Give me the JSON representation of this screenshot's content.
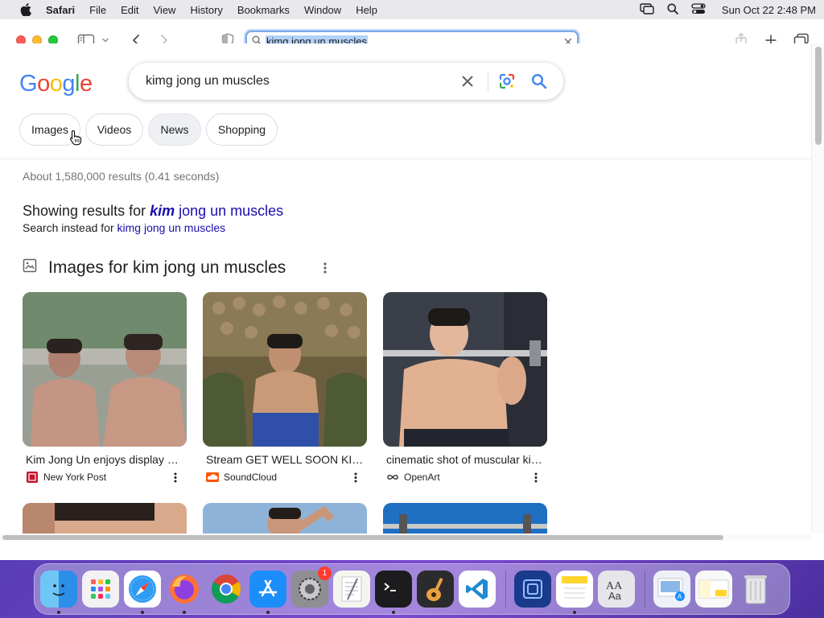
{
  "menubar": {
    "app_name": "Safari",
    "items": [
      "File",
      "Edit",
      "View",
      "History",
      "Bookmarks",
      "Window",
      "Help"
    ],
    "clock": "Sun Oct 22  2:48 PM"
  },
  "browser": {
    "address_text": "kimg jong un muscles"
  },
  "google": {
    "logo": [
      "G",
      "o",
      "o",
      "g",
      "l",
      "e"
    ],
    "logo_colors": [
      "#4285f4",
      "#ea4335",
      "#fbbc05",
      "#4285f4",
      "#34a853",
      "#ea4335"
    ],
    "query": "kimg jong un muscles",
    "chips": [
      "Images",
      "Videos",
      "News",
      "Shopping"
    ],
    "result_stats": "About 1,580,000 results (0.41 seconds)",
    "showing_prefix": "Showing results for ",
    "showing_corrected_bold": "kim",
    "showing_corrected_rest": " jong un muscles",
    "instead_prefix": "Search instead for ",
    "instead_link": "kimg jong un muscles",
    "images_section_title": "Images for kim jong un muscles",
    "image_results": [
      {
        "title": "Kim Jong Un enjoys display of ...",
        "source": "New York Post",
        "favicon": "nypost-icon"
      },
      {
        "title": "Stream GET WELL SOON KIM JONG UN",
        "source": "SoundCloud",
        "favicon": "soundcloud-icon"
      },
      {
        "title": "cinematic shot of muscular kim jong un",
        "source": "OpenArt",
        "favicon": "openart-icon"
      }
    ]
  },
  "dock": {
    "apps": [
      "finder",
      "launchpad",
      "safari",
      "firefox",
      "chrome",
      "app-store",
      "system-settings",
      "textedit",
      "terminal",
      "garageband",
      "vscode",
      "screen-sharing",
      "notes",
      "font-book",
      "preview",
      "notes-2",
      "trash"
    ],
    "settings_badge": "1"
  },
  "colors": {
    "link": "#1a0dab",
    "accent_blue": "#4285f4",
    "address_focus": "#7aa7e8"
  }
}
